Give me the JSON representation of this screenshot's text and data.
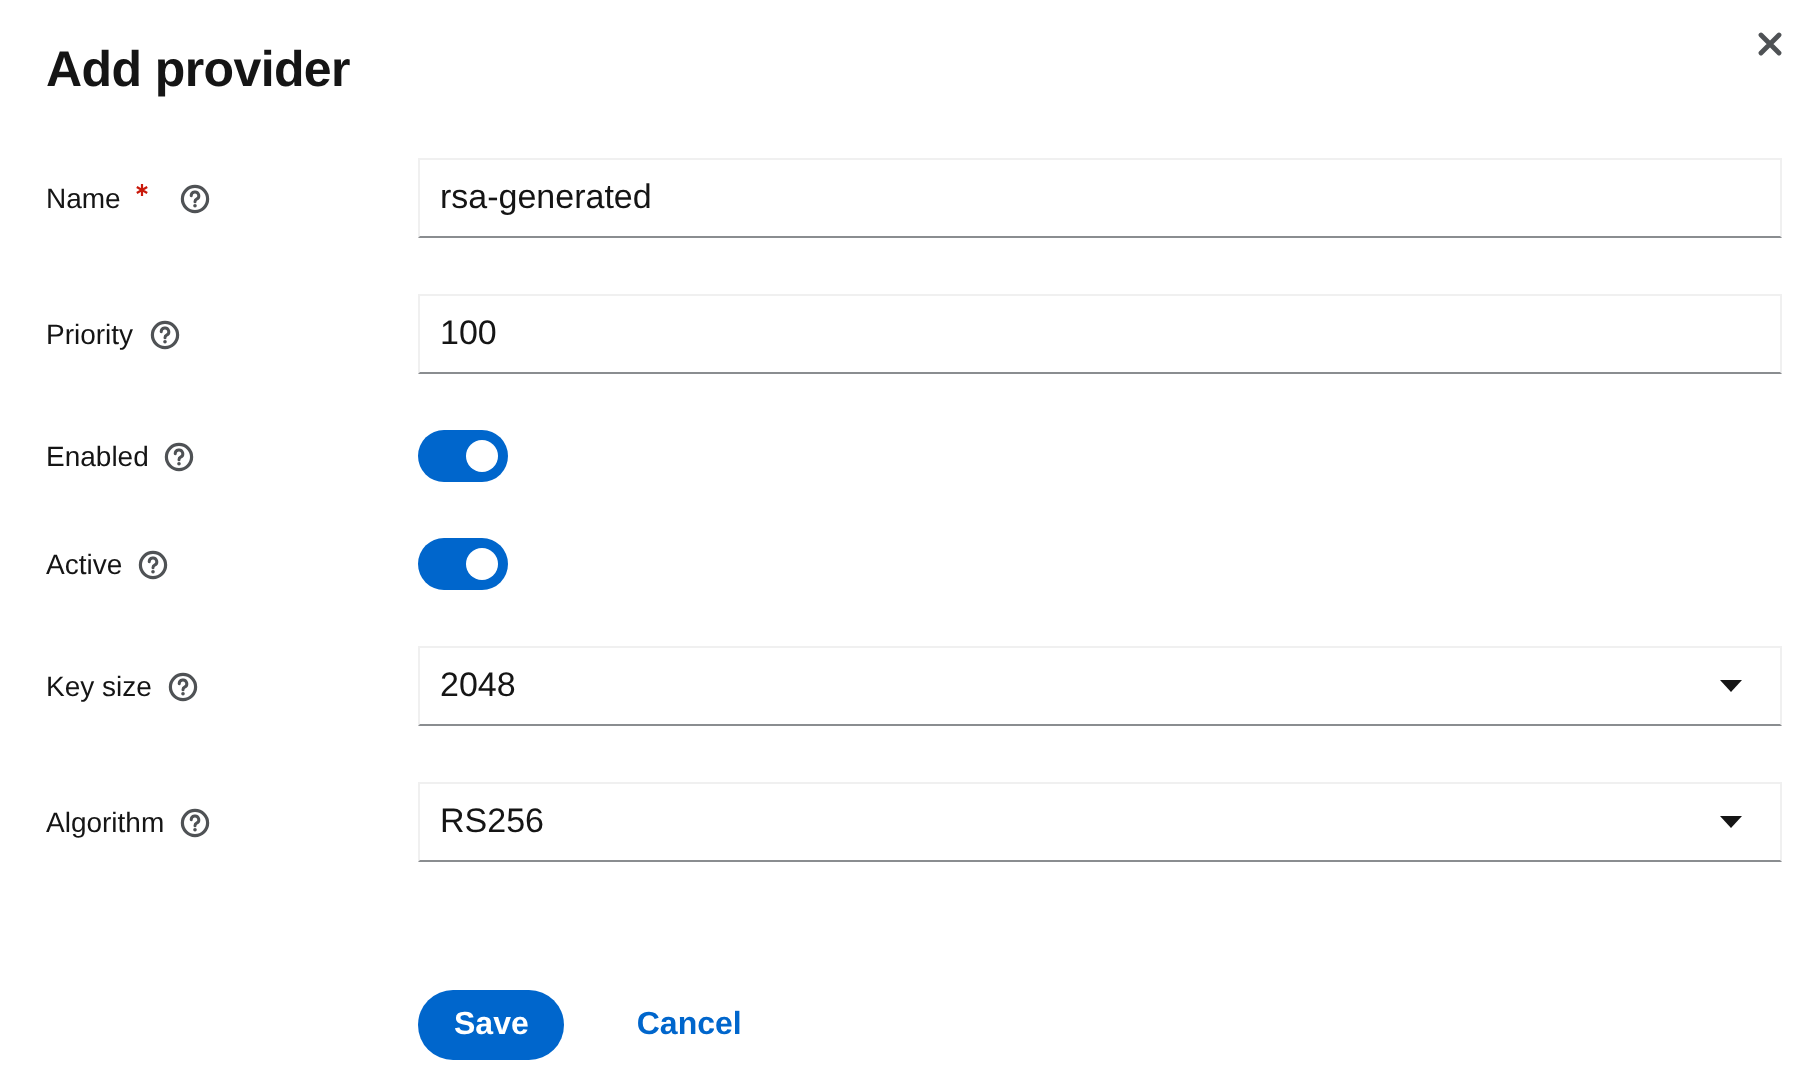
{
  "dialog": {
    "title": "Add provider"
  },
  "fields": [
    {
      "kind": "text",
      "label": "Name",
      "required": true,
      "value": "rsa-generated"
    },
    {
      "kind": "text",
      "label": "Priority",
      "required": false,
      "value": "100"
    },
    {
      "kind": "switch",
      "label": "Enabled",
      "required": false,
      "on": true
    },
    {
      "kind": "switch",
      "label": "Active",
      "required": false,
      "on": true
    },
    {
      "kind": "select",
      "label": "Key size",
      "required": false,
      "value": "2048"
    },
    {
      "kind": "select",
      "label": "Algorithm",
      "required": false,
      "value": "RS256"
    }
  ],
  "buttons": [
    {
      "kind": "primary",
      "label": "Save"
    },
    {
      "kind": "link",
      "label": "Cancel"
    }
  ]
}
